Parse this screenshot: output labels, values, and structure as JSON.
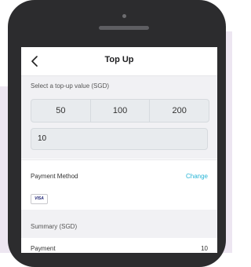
{
  "header": {
    "title": "Top Up",
    "back_icon": "chevron-left-icon"
  },
  "topup": {
    "section_label": "Select a top-up value (SGD)",
    "options": [
      "50",
      "100",
      "200"
    ],
    "input_value": "10"
  },
  "payment": {
    "label": "Payment Method",
    "change_label": "Change",
    "card_brand": "VISA"
  },
  "summary": {
    "label": "Summary (SGD)",
    "rows": [
      {
        "label": "Payment",
        "value": "10"
      }
    ]
  },
  "colors": {
    "accent": "#28b5d6",
    "background_shape": "#ede6f1",
    "phone_frame": "#2c2c2e"
  }
}
